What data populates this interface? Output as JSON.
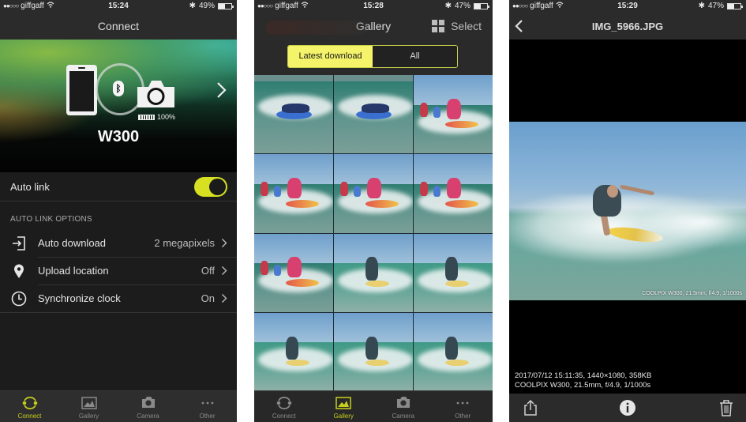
{
  "screens": [
    {
      "status": {
        "carrier": "giffgaff",
        "signal_dots": "●●○○○",
        "time": "15:24",
        "battery": "49%",
        "battery_fraction": 0.49
      },
      "title": "Connect",
      "hero": {
        "device_name": "W300",
        "camera_battery": "100%"
      },
      "auto_link": {
        "label": "Auto link",
        "enabled": true
      },
      "section_header": "AUTO LINK OPTIONS",
      "options": [
        {
          "icon": "download-in-icon",
          "label": "Auto download",
          "value": "2 megapixels"
        },
        {
          "icon": "location-pin-icon",
          "label": "Upload location",
          "value": "Off"
        },
        {
          "icon": "clock-icon",
          "label": "Synchronize clock",
          "value": "On"
        }
      ],
      "tabs": [
        {
          "label": "Connect",
          "icon": "connect-icon",
          "active": true
        },
        {
          "label": "Gallery",
          "icon": "gallery-icon",
          "active": false
        },
        {
          "label": "Camera",
          "icon": "camera-icon",
          "active": false
        },
        {
          "label": "Other",
          "icon": "more-icon",
          "active": false
        }
      ]
    },
    {
      "status": {
        "carrier": "giffgaff",
        "signal_dots": "●●○○○",
        "time": "15:28",
        "battery": "47%",
        "battery_fraction": 0.47
      },
      "title": "Gallery",
      "select_label": "Select",
      "segments": [
        {
          "label": "Latest download",
          "selected": true
        },
        {
          "label": "All",
          "selected": false
        }
      ],
      "thumbnails": [
        {
          "kind": "prone",
          "sky": false
        },
        {
          "kind": "prone",
          "sky": false
        },
        {
          "kind": "group",
          "sky": true
        },
        {
          "kind": "group",
          "sky": true
        },
        {
          "kind": "group",
          "sky": true
        },
        {
          "kind": "group",
          "sky": true
        },
        {
          "kind": "group",
          "sky": true
        },
        {
          "kind": "ride",
          "sky": true
        },
        {
          "kind": "ride",
          "sky": true
        },
        {
          "kind": "ride",
          "sky": true
        },
        {
          "kind": "ride",
          "sky": true
        },
        {
          "kind": "ride",
          "sky": true
        }
      ],
      "tabs": [
        {
          "label": "Connect",
          "icon": "connect-icon",
          "active": false
        },
        {
          "label": "Gallery",
          "icon": "gallery-icon",
          "active": true
        },
        {
          "label": "Camera",
          "icon": "camera-icon",
          "active": false
        },
        {
          "label": "Other",
          "icon": "more-icon",
          "active": false
        }
      ]
    },
    {
      "status": {
        "carrier": "giffgaff",
        "signal_dots": "●●○○○",
        "time": "15:29",
        "battery": "47%",
        "battery_fraction": 0.47
      },
      "title": "IMG_5966.JPG",
      "photo_caption": "COOLPIX W300, 21.5mm, f/4.9, 1/1000s",
      "meta_line1": "2017/07/12 15:11:35, 1440×1080, 358KB",
      "meta_line2": "COOLPIX W300, 21.5mm, f/4.9, 1/1000s",
      "toolbar": [
        "share-icon",
        "info-icon",
        "trash-icon"
      ]
    }
  ],
  "colors": {
    "accent": "#d7e021",
    "segment_selected": "#f4f36a",
    "tab_active": "#c6cf1c",
    "background": "#1c1c1c"
  }
}
